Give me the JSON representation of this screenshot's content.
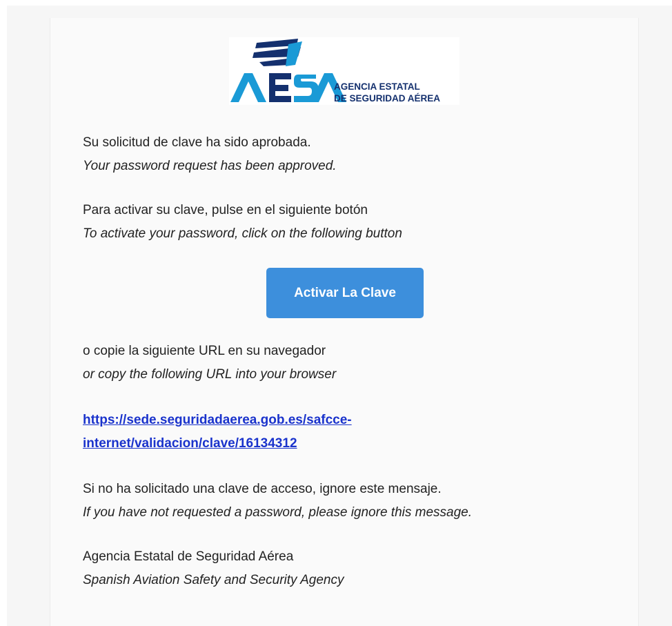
{
  "logo": {
    "acronym": "AESA",
    "name_line1": "AGENCIA ESTATAL",
    "name_line2": "DE SEGURIDAD AÉREA",
    "colors": {
      "dark": "#14306e",
      "teal": "#1a9ad6"
    }
  },
  "message": {
    "approved_es": "Su solicitud de clave ha sido aprobada.",
    "approved_en": "Your password request has been approved.",
    "activate_es": "Para activar su clave, pulse en el siguiente botón",
    "activate_en": "To activate your password, click on the following button",
    "button_label": "Activar La Clave",
    "copy_es": "o copie la siguiente URL en su navegador",
    "copy_en": "or copy the following URL into your browser",
    "url_line1": "https://sede.seguridadaerea.gob.es/safcce-",
    "url_line2": "internet/validacion/clave/16134312",
    "ignore_es": "Si no ha solicitado una clave de acceso, ignore este mensaje.",
    "ignore_en": "If you have not requested a password, please ignore this message.",
    "agency_es": "Agencia Estatal de Seguridad Aérea",
    "agency_en": "Spanish Aviation Safety and Security Agency"
  },
  "colors": {
    "button": "#3d8fdc",
    "link": "#1a33cc"
  }
}
